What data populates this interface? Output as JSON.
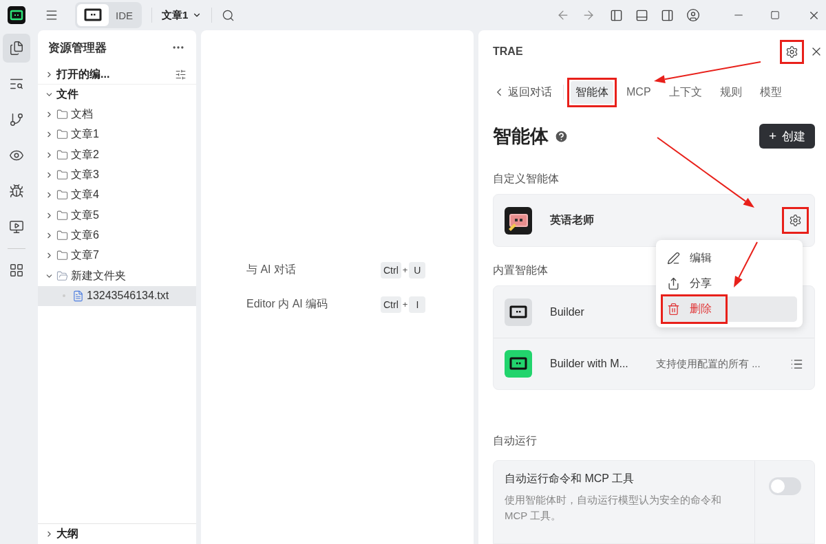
{
  "top_bar": {
    "modes": [
      {
        "kind": "solo",
        "selected": true
      },
      {
        "kind": "ide",
        "label": "IDE",
        "selected": false
      }
    ],
    "project": "文章1"
  },
  "activity_bar": [
    {
      "kind": "files",
      "selected": true
    },
    {
      "kind": "search",
      "selected": false
    },
    {
      "kind": "branch",
      "selected": false
    },
    {
      "kind": "preview",
      "selected": false
    },
    {
      "kind": "debug",
      "selected": false
    },
    {
      "kind": "remote",
      "selected": false
    },
    {
      "kind": "extensions",
      "selected": false
    }
  ],
  "explorer": {
    "title": "资源管理器",
    "sections": [
      {
        "label": "打开的编...",
        "expanded": false
      },
      {
        "label": "文件",
        "expanded": true
      }
    ],
    "tree": [
      {
        "label": "文档",
        "kind": "folder",
        "expanded": false,
        "selected": false
      },
      {
        "label": "文章1",
        "kind": "folder",
        "expanded": false,
        "selected": false
      },
      {
        "label": "文章2",
        "kind": "folder",
        "expanded": false,
        "selected": false
      },
      {
        "label": "文章3",
        "kind": "folder",
        "expanded": false,
        "selected": false
      },
      {
        "label": "文章4",
        "kind": "folder",
        "expanded": false,
        "selected": false
      },
      {
        "label": "文章5",
        "kind": "folder",
        "expanded": false,
        "selected": false
      },
      {
        "label": "文章6",
        "kind": "folder",
        "expanded": false,
        "selected": false
      },
      {
        "label": "文章7",
        "kind": "folder",
        "expanded": false,
        "selected": false
      },
      {
        "label": "新建文件夹",
        "kind": "folder",
        "expanded": true,
        "selected": false,
        "children": [
          {
            "label": "13243546134.txt",
            "kind": "file",
            "selected": true
          }
        ]
      }
    ],
    "outline": {
      "label": "大纲",
      "expanded": false
    }
  },
  "shortcuts": [
    {
      "label": "与 AI 对话",
      "keys": [
        "Ctrl",
        "U"
      ],
      "plus": "+"
    },
    {
      "label": "Editor 内 AI 编码",
      "keys": [
        "Ctrl",
        "I"
      ],
      "plus": "+"
    }
  ],
  "panel": {
    "title": "TRAE",
    "settings_highlighted": true,
    "back": "返回对话",
    "tabs": [
      {
        "label": "智能体",
        "selected": true,
        "highlighted": true
      },
      {
        "label": "MCP",
        "selected": false,
        "highlighted": false
      },
      {
        "label": "上下文",
        "selected": false,
        "highlighted": false
      },
      {
        "label": "规则",
        "selected": false,
        "highlighted": false
      },
      {
        "label": "模型",
        "selected": false,
        "highlighted": false
      }
    ],
    "heading": "智能体",
    "create_button": {
      "plus": "+",
      "label": "创建"
    },
    "custom_section": "自定义智能体",
    "custom_agents": [
      {
        "name": "英语老师",
        "settings_highlighted": true
      }
    ],
    "menu": [
      {
        "label": "编辑",
        "kind": "edit",
        "hovered": false,
        "highlighted": false
      },
      {
        "label": "分享",
        "kind": "share",
        "hovered": false,
        "highlighted": false
      },
      {
        "label": "删除",
        "kind": "delete",
        "hovered": true,
        "highlighted": true
      }
    ],
    "builtin_section": "内置智能体",
    "builtin_agents": [
      {
        "name": "Builder",
        "kind": "gray"
      },
      {
        "name": "Builder with M...",
        "kind": "green",
        "description": "支持使用配置的所有 ..."
      }
    ],
    "auto_section": "自动运行",
    "auto_setting": {
      "title": "自动运行命令和 MCP 工具",
      "description": "使用智能体时，自动运行模型认为安全的命令和 MCP 工具。",
      "on": false
    }
  }
}
